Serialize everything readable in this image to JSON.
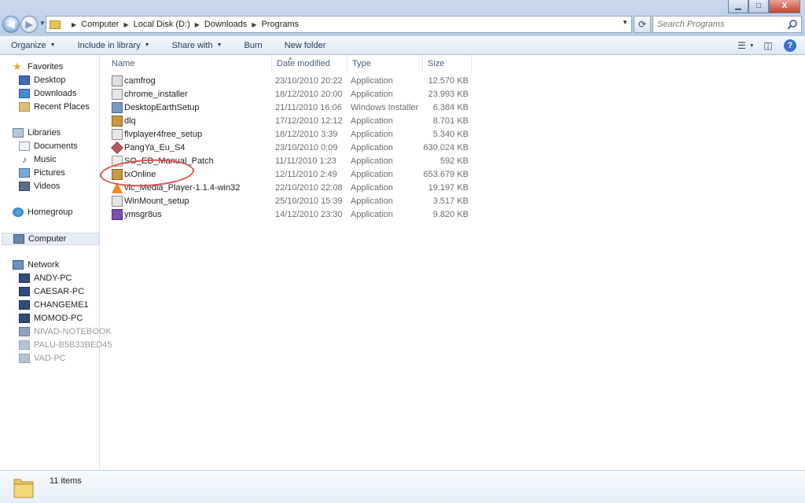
{
  "window": {
    "min_label": "▁",
    "max_label": "□",
    "close_label": "X"
  },
  "address": {
    "crumbs": [
      "Computer",
      "Local Disk (D:)",
      "Downloads",
      "Programs"
    ],
    "search_placeholder": "Search Programs"
  },
  "toolbar": {
    "organize": "Organize",
    "include_in_library": "Include in library",
    "share_with": "Share with",
    "burn": "Burn",
    "new_folder": "New folder"
  },
  "columns": {
    "name": "Name",
    "date_modified": "Date modified",
    "type": "Type",
    "size": "Size"
  },
  "sidebar": {
    "favorites": {
      "label": "Favorites",
      "items": [
        "Desktop",
        "Downloads",
        "Recent Places"
      ]
    },
    "libraries": {
      "label": "Libraries",
      "items": [
        "Documents",
        "Music",
        "Pictures",
        "Videos"
      ]
    },
    "homegroup": "Homegroup",
    "computer": "Computer",
    "network": {
      "label": "Network",
      "items": [
        "ANDY-PC",
        "CAESAR-PC",
        "CHANGEME1",
        "MOMOD-PC",
        "NIVAD-NOTEBOOK",
        "PALU-B5B33BED45",
        "VAD-PC"
      ]
    }
  },
  "files": [
    {
      "name": "camfrog",
      "date": "23/10/2010 20:22",
      "type": "Application",
      "size": "12.570 KB"
    },
    {
      "name": "chrome_installer",
      "date": "18/12/2010 20:00",
      "type": "Application",
      "size": "23.993 KB"
    },
    {
      "name": "DesktopEarthSetup",
      "date": "21/11/2010 16:06",
      "type": "Windows Installer ...",
      "size": "6.384 KB"
    },
    {
      "name": "dlq",
      "date": "17/12/2010 12:12",
      "type": "Application",
      "size": "8.701 KB"
    },
    {
      "name": "flvplayer4free_setup",
      "date": "18/12/2010 3:39",
      "type": "Application",
      "size": "5.340 KB"
    },
    {
      "name": "PangYa_Eu_S4",
      "date": "23/10/2010 0:09",
      "type": "Application",
      "size": "630.024 KB"
    },
    {
      "name": "SO_ED_Manual_Patch",
      "date": "11/11/2010 1:23",
      "type": "Application",
      "size": "592 KB"
    },
    {
      "name": "txOnline",
      "date": "12/11/2010 2:49",
      "type": "Application",
      "size": "653.679 KB"
    },
    {
      "name": "vlc_Media_Player-1.1.4-win32",
      "date": "22/10/2010 22:08",
      "type": "Application",
      "size": "19.197 KB"
    },
    {
      "name": "WinMount_setup",
      "date": "25/10/2010 15:39",
      "type": "Application",
      "size": "3.517 KB"
    },
    {
      "name": "ymsgr8us",
      "date": "14/12/2010 23:30",
      "type": "Application",
      "size": "9.820 KB"
    }
  ],
  "status": {
    "item_count": "11 items"
  },
  "colors": {
    "highlight_circle": "#d9534f",
    "accent": "#1e395b"
  }
}
